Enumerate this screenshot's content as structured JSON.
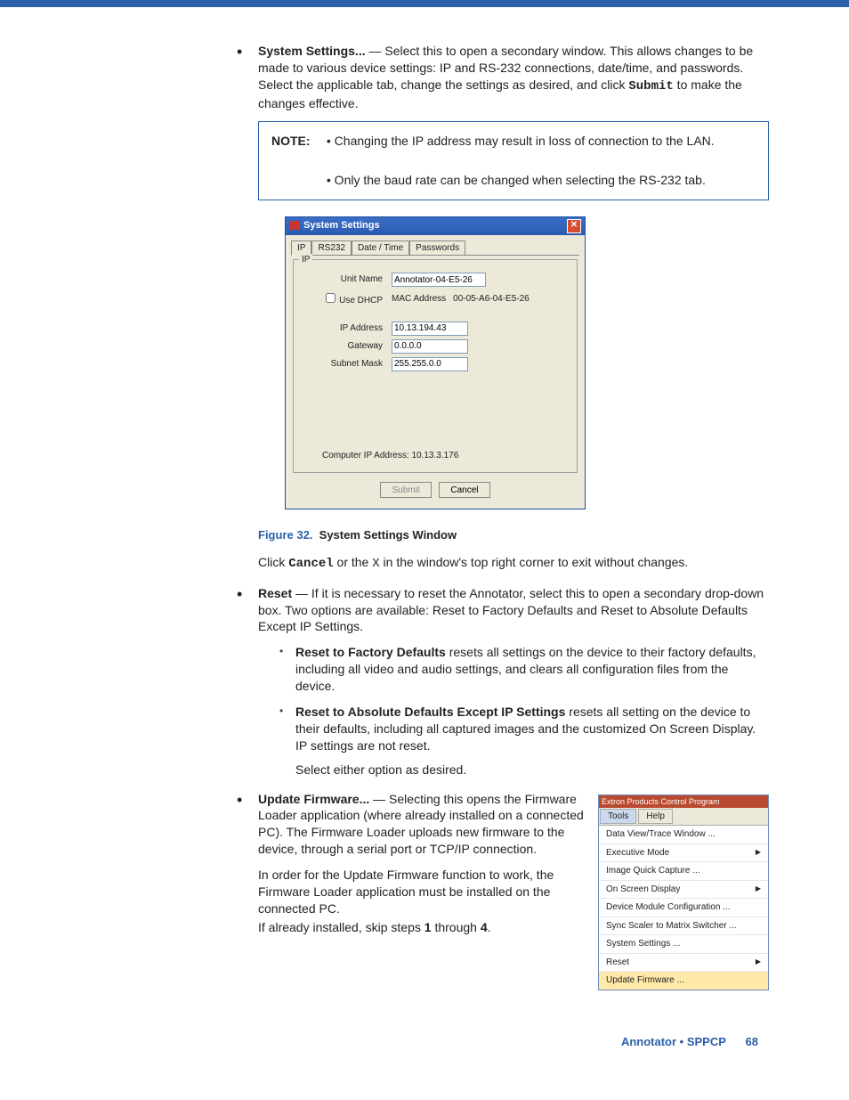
{
  "bullet1": {
    "title": "System Settings...",
    "text": " — Select this to open a secondary window. This allows changes to be made to various device settings: IP and RS-232 connections, date/time, and passwords. Select the applicable tab, change the settings as desired, and click ",
    "submit": "Submit",
    "text2": " to make the changes effective."
  },
  "note": {
    "label": "NOTE:",
    "line1": "• Changing the IP address may result in loss of connection to the LAN.",
    "line2": "• Only the baud rate can be changed when selecting the RS-232 tab."
  },
  "dialog": {
    "title": "System Settings",
    "tabs": [
      "IP",
      "RS232",
      "Date / Time",
      "Passwords"
    ],
    "group": "IP",
    "labels": {
      "unitName": "Unit Name",
      "useDhcp": "Use DHCP",
      "macAddress": "MAC Address",
      "ipAddress": "IP Address",
      "gateway": "Gateway",
      "subnet": "Subnet Mask"
    },
    "values": {
      "unitName": "Annotator-04-E5-26",
      "mac": "00-05-A6-04-E5-26",
      "ip": "10.13.194.43",
      "gateway": "0.0.0.0",
      "subnet": "255.255.0.0"
    },
    "compIpLbl": "Computer IP Address:",
    "compIp": "10.13.3.176",
    "submit": "Submit",
    "cancel": "Cancel"
  },
  "figure": {
    "num": "Figure 32.",
    "title": "System Settings Window"
  },
  "afterFigure": {
    "pre": "Click ",
    "cancel": "Cancel",
    "mid": " or the ",
    "x": "X",
    "post": " in the window's top right corner to exit without changes."
  },
  "reset": {
    "title": "Reset",
    "text": " — If it is necessary to reset the Annotator, select this to open a secondary drop-down box. Two options are available: Reset to Factory Defaults and Reset to Absolute Defaults Except IP Settings.",
    "sub1": {
      "t": "Reset to Factory Defaults",
      "d": " resets all settings on the device to their factory defaults, including all video and audio settings, and clears all configuration files from the device."
    },
    "sub2": {
      "t": "Reset to Absolute Defaults Except IP Settings",
      "d": " resets all setting on the device to their defaults, including all captured images and the customized On Screen Display. IP settings are not reset."
    },
    "select": "Select either option as desired."
  },
  "update": {
    "title": "Update Firmware...",
    "p1": " — Selecting this opens the Firmware Loader application (where already installed on a connected PC). The Firmware Loader uploads new firmware to the device, through a serial port or TCP/IP connection.",
    "p2a": "In order for the Update Firmware function to work, the Firmware Loader application must be installed on the connected PC.",
    "p2b_pre": "If already installed, skip steps ",
    "p2b_1": "1",
    "p2b_mid": " through ",
    "p2b_4": "4",
    "p2b_post": "."
  },
  "toolsMenu": {
    "titlebar": "Extron Products Control Program",
    "tools": "Tools",
    "help": "Help",
    "items": [
      {
        "l": "Data View/Trace Window ...",
        "a": false
      },
      {
        "l": "Executive Mode",
        "a": true
      },
      {
        "l": "Image Quick Capture ...",
        "a": false
      },
      {
        "l": "On Screen Display",
        "a": true
      },
      {
        "l": "Device Module Configuration ...",
        "a": false
      },
      {
        "l": "Sync Scaler to Matrix Switcher ...",
        "a": false
      },
      {
        "l": "System Settings ...",
        "a": false
      },
      {
        "l": "Reset",
        "a": true
      },
      {
        "l": "Update Firmware ...",
        "a": false,
        "hl": true
      }
    ]
  },
  "footer": {
    "doc": "Annotator • SPPCP",
    "page": "68"
  }
}
